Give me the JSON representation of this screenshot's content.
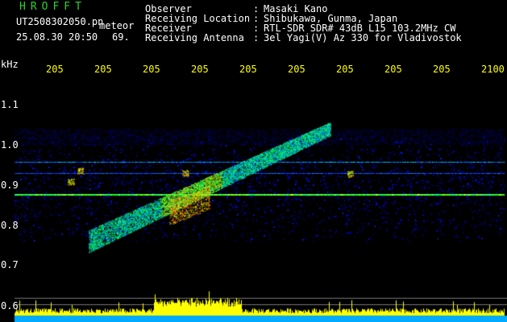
{
  "header": {
    "app_name": "HROFFT",
    "filename": "UT2508302050.pn",
    "tag": "meteor",
    "datetime": "25.08.30 20:50",
    "count": "69.",
    "info": [
      {
        "label": "Observer",
        "sep": ":",
        "value": "Masaki Kano"
      },
      {
        "label": "Receiving Location",
        "sep": ":",
        "value": "Shibukawa, Gunma, Japan"
      },
      {
        "label": "Receiver",
        "sep": ":",
        "value": "RTL-SDR SDR# 43dB L15 103.2MHz CW"
      },
      {
        "label": "Receiving Antenna",
        "sep": ":",
        "value": "3el Yagi(V) Az 330 for Vladivostok"
      }
    ]
  },
  "axis": {
    "unit": "kHz",
    "time_labels": [
      "205",
      "205",
      "205",
      "205",
      "205",
      "205",
      "205",
      "205",
      "205",
      "2100"
    ],
    "freq_labels": [
      "1.1",
      "1.0",
      "0.9",
      "0.8",
      "0.7",
      "0.6"
    ]
  },
  "colors": {
    "background": "#000000",
    "time_label": "#ffff00",
    "app_name": "#2bd42b",
    "histogram": "#ffff00",
    "bottom_band": "#00aaff"
  }
}
